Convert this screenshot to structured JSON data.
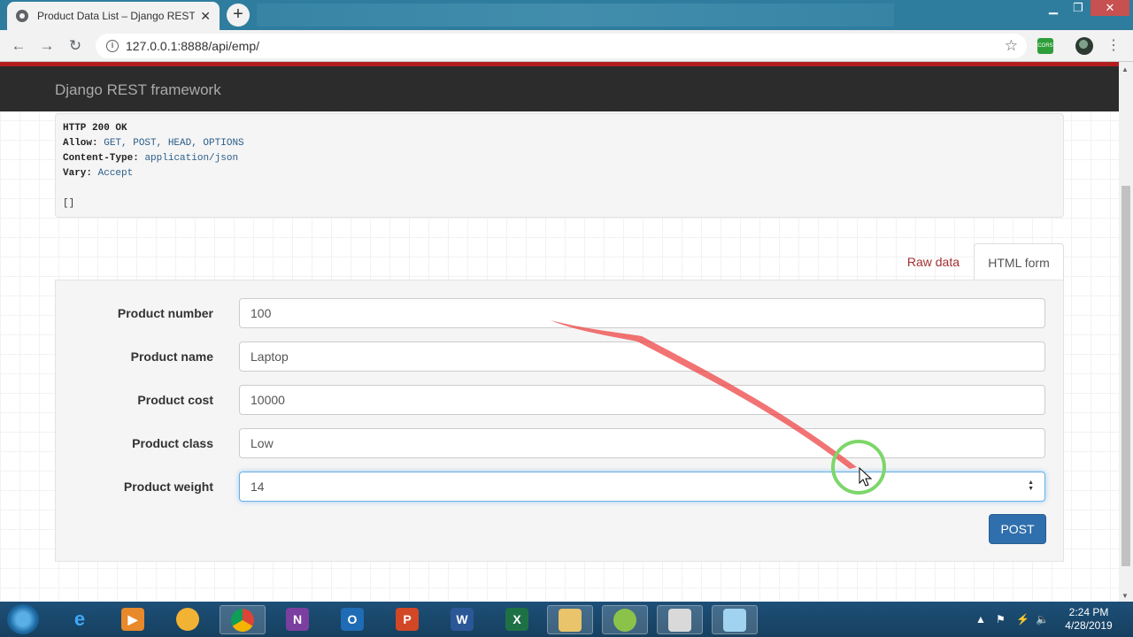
{
  "browser": {
    "tab_title": "Product Data List – Django REST",
    "tab_close": "✕",
    "new_tab": "+",
    "url": "127.0.0.1:8888/api/emp/",
    "ext_cors": "CORS"
  },
  "page": {
    "brand": "Django REST framework",
    "response": {
      "status": "HTTP 200 OK",
      "allow_key": "Allow:",
      "allow_val": "GET, POST, HEAD, OPTIONS",
      "ctype_key": "Content-Type:",
      "ctype_val": "application/json",
      "vary_key": "Vary:",
      "vary_val": "Accept",
      "body": "[]"
    },
    "tabs": {
      "raw": "Raw data",
      "form": "HTML form"
    },
    "form": {
      "fields": [
        {
          "label": "Product number",
          "value": "100"
        },
        {
          "label": "Product name",
          "value": "Laptop"
        },
        {
          "label": "Product cost",
          "value": "10000"
        },
        {
          "label": "Product class",
          "value": "Low"
        },
        {
          "label": "Product weight",
          "value": "14"
        }
      ],
      "submit": "POST"
    }
  },
  "taskbar": {
    "time": "2:24 PM",
    "date": "4/28/2019",
    "apps": [
      "IE",
      "Media",
      "Paint",
      "Chrome",
      "OneNote",
      "Outlook",
      "PowerPoint",
      "Word",
      "Excel",
      "Explorer",
      "Tool",
      "Monitor",
      "Notepad"
    ]
  }
}
